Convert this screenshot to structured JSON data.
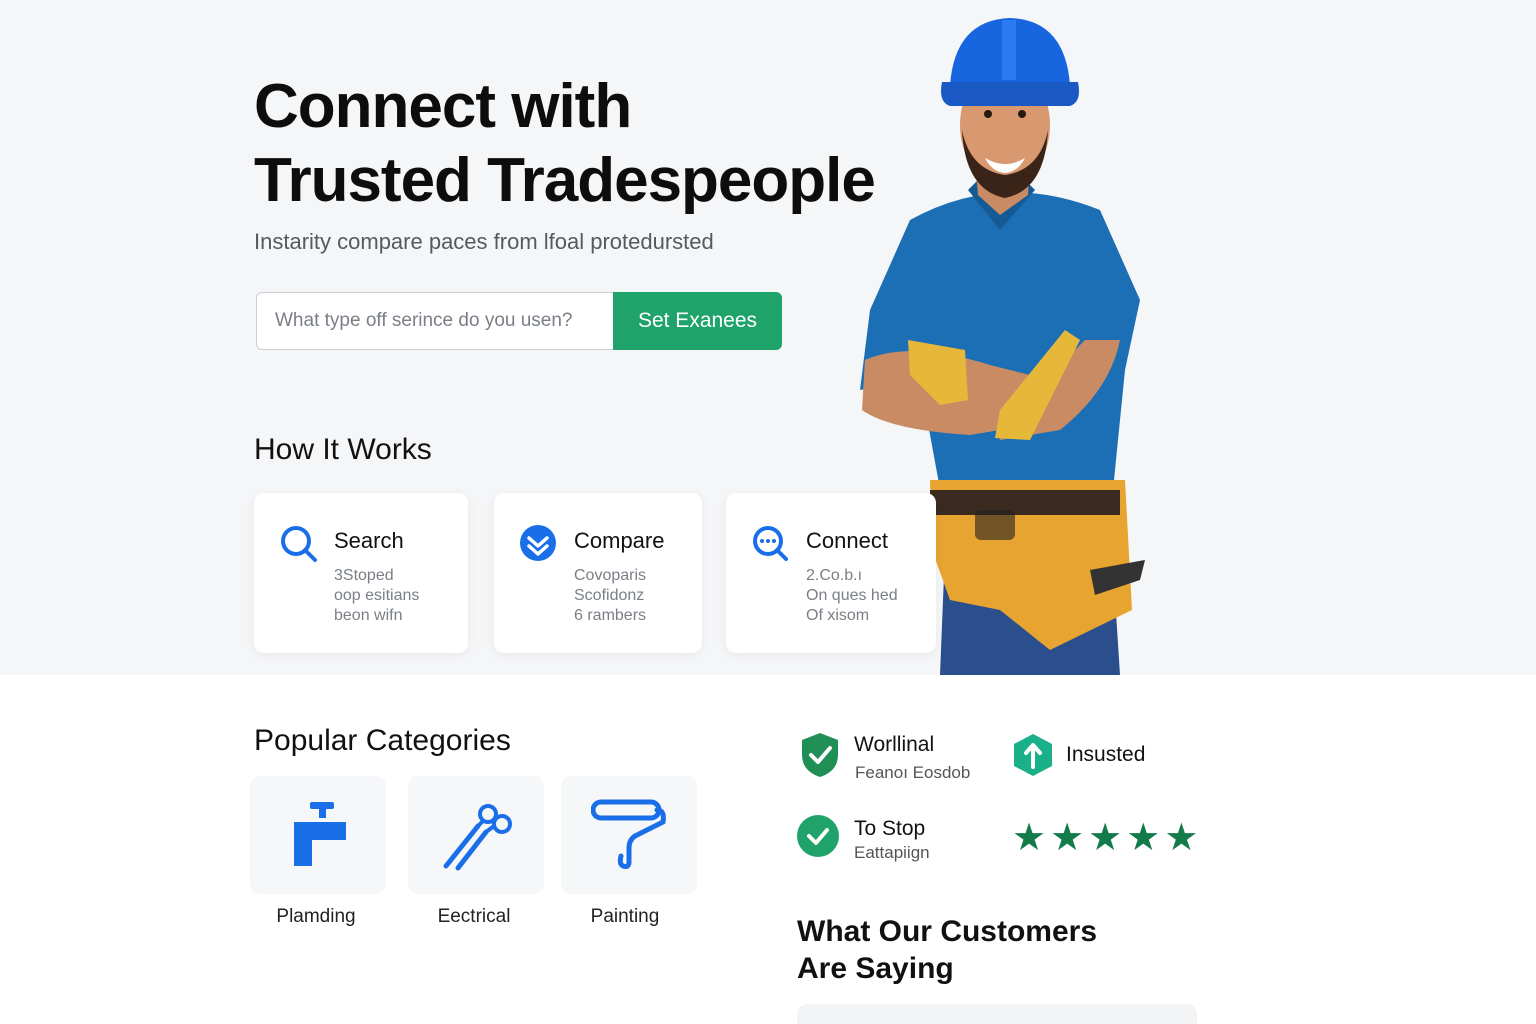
{
  "hero": {
    "title_line1": "Connect with",
    "title_line2": "Trusted Tradespeople",
    "subtitle": "Instarity compare paces from lfoal protedursted",
    "search_placeholder": "What type off serince do you usen?",
    "search_button": "Set Exanees",
    "worker_image": "tradesperson-photo"
  },
  "how_it_works": {
    "title": "How It Works",
    "steps": [
      {
        "icon": "search-icon",
        "label": "Search",
        "lines": [
          "3Stoped",
          "oop esitians",
          "beon wifn"
        ]
      },
      {
        "icon": "compare-icon",
        "label": "Compare",
        "lines": [
          "Covoparis",
          "Scofidonz",
          "6 rambers"
        ]
      },
      {
        "icon": "chat-icon",
        "label": "Connect",
        "lines": [
          "2.Co.b.ı",
          "On ques hed",
          "Of xisom"
        ]
      }
    ]
  },
  "categories": {
    "title": "Popular Categories",
    "items": [
      {
        "icon": "faucet-icon",
        "label": "Plamding"
      },
      {
        "icon": "pliers-icon",
        "label": "Eectrical"
      },
      {
        "icon": "paint-roller-icon",
        "label": "Painting"
      }
    ]
  },
  "trust": {
    "badges": [
      {
        "icon": "shield-check-icon",
        "title": "Worllinal",
        "sub": "Feanoı Eosdob"
      },
      {
        "icon": "insured-arrow-icon",
        "title": "Insusted",
        "sub": ""
      },
      {
        "icon": "check-circle-icon",
        "title": "To Stop",
        "sub": "Eattapiign"
      }
    ],
    "rating_stars": 5,
    "star_char": "★"
  },
  "testimonials": {
    "title_line1": "What Our Customers",
    "title_line2": "Are Saying"
  },
  "colors": {
    "accent_blue": "#1a6fe8",
    "accent_green": "#1fa36b",
    "star_green": "#137a4a",
    "hero_bg": "#f5f6f8"
  }
}
